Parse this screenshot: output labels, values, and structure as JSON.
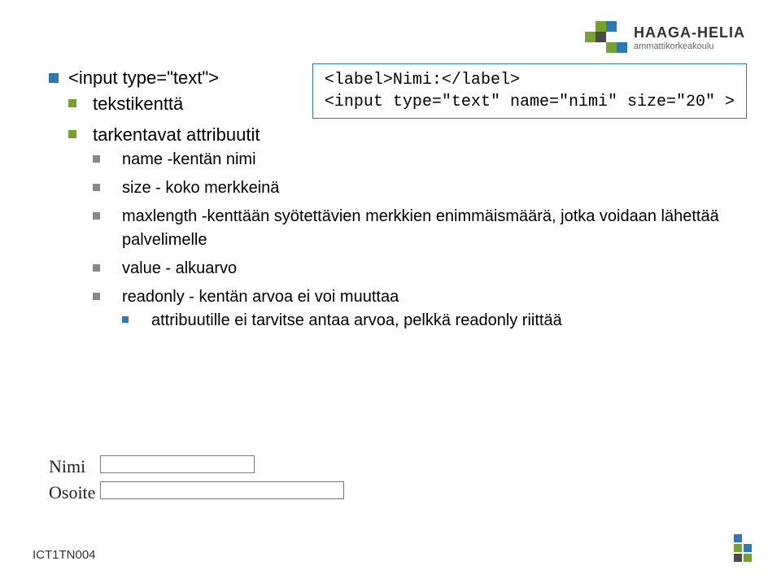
{
  "logo": {
    "title": "HAAGA-HELIA",
    "subtitle": "ammattikorkeakoulu"
  },
  "codebox": {
    "line1": "<label>Nimi:</label>",
    "line2": "<input type=\"text\" name=\"nimi\" size=\"20\" >"
  },
  "list": {
    "l1": "<input type=\"text\">",
    "l1_1": "tekstikenttä",
    "l1_2": "tarkentavat attribuutit",
    "l1_2_1": "name -kentän nimi",
    "l1_2_2": "size - koko merkkeinä",
    "l1_2_3": "maxlength -kenttään syötettävien merkkien enimmäismäärä, jotka voidaan lähettää palvelimelle",
    "l1_2_4": "value - alkuarvo",
    "l1_2_5": "readonly - kentän arvoa ei voi muuttaa",
    "l1_2_5_1": "attribuutille ei tarvitse antaa arvoa, pelkkä readonly riittää"
  },
  "formfig": {
    "nimi": "Nimi",
    "osoite": "Osoite"
  },
  "footer": {
    "code": "ICT1TN004"
  }
}
